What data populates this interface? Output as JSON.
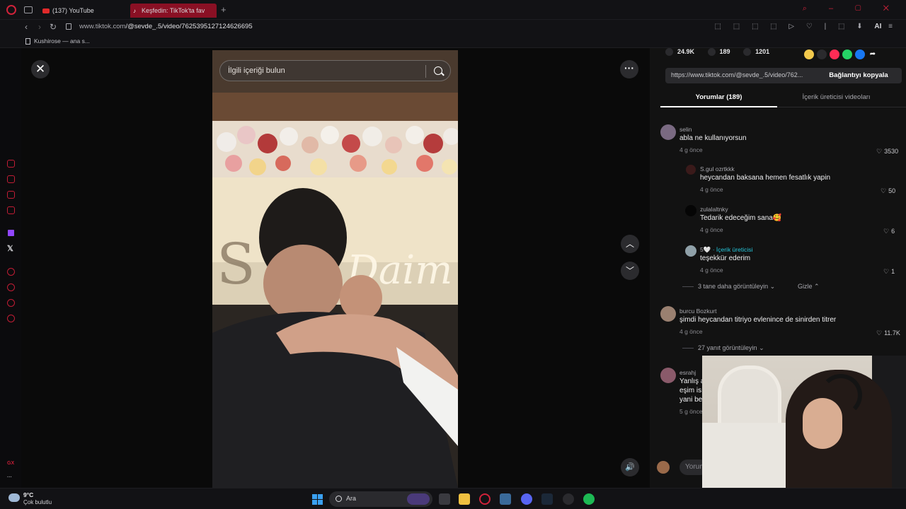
{
  "browser": {
    "tabs": [
      {
        "label": "(137) YouTube"
      },
      {
        "label": "Keşfedin: TikTok'ta fav"
      }
    ],
    "url_domain": "www.tiktok.com",
    "url_path": "/@sevde_.5/video/7625395127124626695",
    "bookmark": "Kushirose — ana s...",
    "ai_label": "AI"
  },
  "video": {
    "search_placeholder": "İlgili içeriği bulun"
  },
  "panel": {
    "likes": "24.9K",
    "comments": "189",
    "saves": "1201",
    "link_url": "https://www.tiktok.com/@sevde_.5/video/762...",
    "copy_label": "Bağlantıyı kopyala",
    "tab_comments": "Yorumlar (189)",
    "tab_creator_videos": "İçerik üreticisi videoları",
    "comments_list": [
      {
        "user": "selin",
        "text": "abla ne kullanıyorsun",
        "time": "4 g önce",
        "likes": "3530"
      },
      {
        "user": "S.gul ozrtkkk",
        "text": "heycandan baksana hemen fesatlık yapin",
        "time": "4 g önce",
        "likes": "50"
      },
      {
        "user": "zulalaltnky",
        "text": "Tedarik edeceğim sana🥰",
        "time": "4 g önce",
        "likes": "6"
      },
      {
        "user": "5🤍",
        "creator_tag": "· İçerik üreticisi",
        "text": "teşekkür ederim",
        "time": "4 g önce",
        "likes": "1"
      },
      {
        "user": "burcu Bozkurt",
        "text": "şimdi heycandan titriyo evlenince de sinirden titrer",
        "time": "4 g önce",
        "likes": "11.7K"
      },
      {
        "user": "esrahj",
        "text": "Yanlış a",
        "text2": "eşim is",
        "text3": "yani be",
        "time": "5 g önce"
      }
    ],
    "view_more_1": "3 tane daha görüntüleyin",
    "hide_label": "Gizle",
    "view_more_2": "27 yanıt görüntüleyin",
    "comment_input_placeholder": "Yorum"
  },
  "taskbar": {
    "temp": "9°C",
    "weather": "Çok bulutlu",
    "search_label": "Ara"
  },
  "colors": {
    "accent": "#d0223a",
    "creator": "#26c6da",
    "panel_bg": "#121212"
  }
}
